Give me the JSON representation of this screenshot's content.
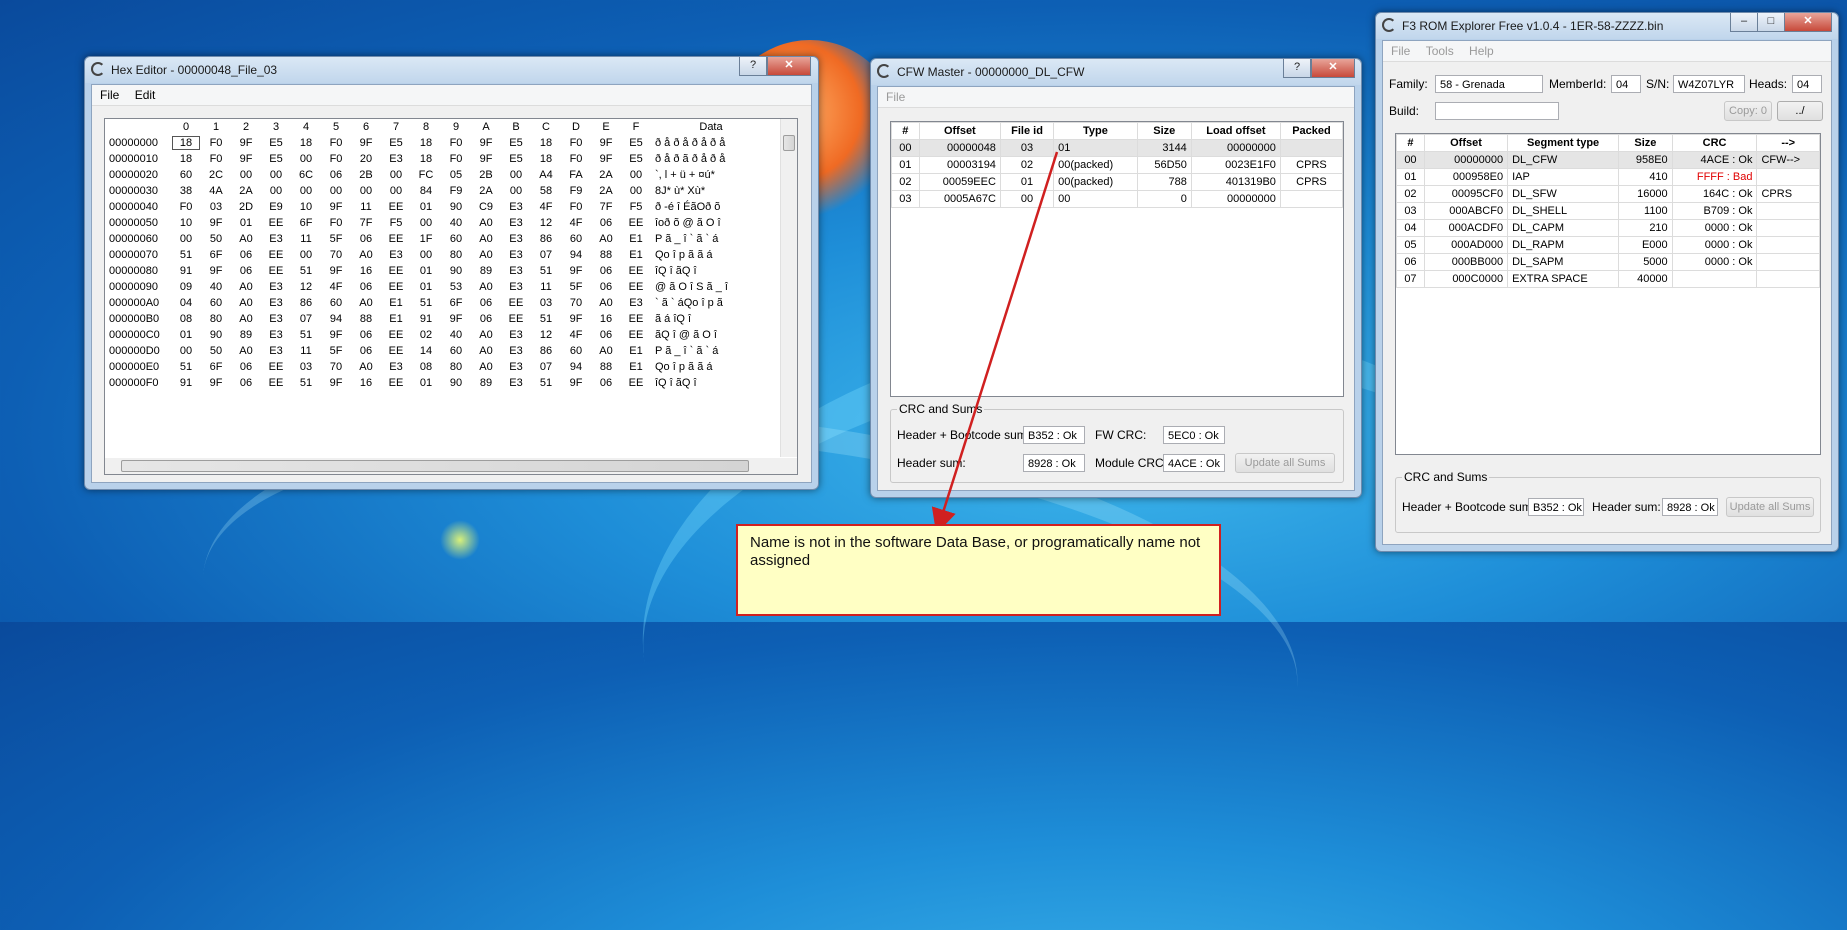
{
  "hex_editor": {
    "title": "Hex Editor - 00000048_File_03",
    "menu": [
      "File",
      "Edit"
    ],
    "columns": [
      "0",
      "1",
      "2",
      "3",
      "4",
      "5",
      "6",
      "7",
      "8",
      "9",
      "A",
      "B",
      "C",
      "D",
      "E",
      "F"
    ],
    "data_header": "Data",
    "rows": [
      {
        "addr": "00000000",
        "bytes": [
          "18",
          "F0",
          "9F",
          "E5",
          "18",
          "F0",
          "9F",
          "E5",
          "18",
          "F0",
          "9F",
          "E5",
          "18",
          "F0",
          "9F",
          "E5"
        ],
        "ascii": "ð å ð å ð å ð å"
      },
      {
        "addr": "00000010",
        "bytes": [
          "18",
          "F0",
          "9F",
          "E5",
          "00",
          "F0",
          "20",
          "E3",
          "18",
          "F0",
          "9F",
          "E5",
          "18",
          "F0",
          "9F",
          "E5"
        ],
        "ascii": "ð å ð ã ð å ð å"
      },
      {
        "addr": "00000020",
        "bytes": [
          "60",
          "2C",
          "00",
          "00",
          "6C",
          "06",
          "2B",
          "00",
          "FC",
          "05",
          "2B",
          "00",
          "A4",
          "FA",
          "2A",
          "00"
        ],
        "ascii": "`,   l + ü + ¤ú*"
      },
      {
        "addr": "00000030",
        "bytes": [
          "38",
          "4A",
          "2A",
          "00",
          "00",
          "00",
          "00",
          "00",
          "84",
          "F9",
          "2A",
          "00",
          "58",
          "F9",
          "2A",
          "00"
        ],
        "ascii": "8J*   ù* Xù*"
      },
      {
        "addr": "00000040",
        "bytes": [
          "F0",
          "03",
          "2D",
          "E9",
          "10",
          "9F",
          "11",
          "EE",
          "01",
          "90",
          "C9",
          "E3",
          "4F",
          "F0",
          "7F",
          "F5"
        ],
        "ascii": "ð -é  î ÉãOð õ"
      },
      {
        "addr": "00000050",
        "bytes": [
          "10",
          "9F",
          "01",
          "EE",
          "6F",
          "F0",
          "7F",
          "F5",
          "00",
          "40",
          "A0",
          "E3",
          "12",
          "4F",
          "06",
          "EE"
        ],
        "ascii": "  îoð õ @ ã O î"
      },
      {
        "addr": "00000060",
        "bytes": [
          "00",
          "50",
          "A0",
          "E3",
          "11",
          "5F",
          "06",
          "EE",
          "1F",
          "60",
          "A0",
          "E3",
          "86",
          "60",
          "A0",
          "E1"
        ],
        "ascii": " P ã _ î ` ã  ` á"
      },
      {
        "addr": "00000070",
        "bytes": [
          "51",
          "6F",
          "06",
          "EE",
          "00",
          "70",
          "A0",
          "E3",
          "00",
          "80",
          "A0",
          "E3",
          "07",
          "94",
          "88",
          "E1"
        ],
        "ascii": "Qo î p ã  ã   á"
      },
      {
        "addr": "00000080",
        "bytes": [
          "91",
          "9F",
          "06",
          "EE",
          "51",
          "9F",
          "16",
          "EE",
          "01",
          "90",
          "89",
          "E3",
          "51",
          "9F",
          "06",
          "EE"
        ],
        "ascii": " îQ î  ãQ î"
      },
      {
        "addr": "00000090",
        "bytes": [
          "09",
          "40",
          "A0",
          "E3",
          "12",
          "4F",
          "06",
          "EE",
          "01",
          "53",
          "A0",
          "E3",
          "11",
          "5F",
          "06",
          "EE"
        ],
        "ascii": " @ ã O î S ã _ î"
      },
      {
        "addr": "000000A0",
        "bytes": [
          "04",
          "60",
          "A0",
          "E3",
          "86",
          "60",
          "A0",
          "E1",
          "51",
          "6F",
          "06",
          "EE",
          "03",
          "70",
          "A0",
          "E3"
        ],
        "ascii": " ` ã `  áQo î p ã"
      },
      {
        "addr": "000000B0",
        "bytes": [
          "08",
          "80",
          "A0",
          "E3",
          "07",
          "94",
          "88",
          "E1",
          "91",
          "9F",
          "06",
          "EE",
          "51",
          "9F",
          "16",
          "EE"
        ],
        "ascii": "  ã   á  îQ î"
      },
      {
        "addr": "000000C0",
        "bytes": [
          "01",
          "90",
          "89",
          "E3",
          "51",
          "9F",
          "06",
          "EE",
          "02",
          "40",
          "A0",
          "E3",
          "12",
          "4F",
          "06",
          "EE"
        ],
        "ascii": " ãQ î @ ã O î"
      },
      {
        "addr": "000000D0",
        "bytes": [
          "00",
          "50",
          "A0",
          "E3",
          "11",
          "5F",
          "06",
          "EE",
          "14",
          "60",
          "A0",
          "E3",
          "86",
          "60",
          "A0",
          "E1"
        ],
        "ascii": " P ã _ î ` ã  ` á"
      },
      {
        "addr": "000000E0",
        "bytes": [
          "51",
          "6F",
          "06",
          "EE",
          "03",
          "70",
          "A0",
          "E3",
          "08",
          "80",
          "A0",
          "E3",
          "07",
          "94",
          "88",
          "E1"
        ],
        "ascii": "Qo î p ã  ã   á"
      },
      {
        "addr": "000000F0",
        "bytes": [
          "91",
          "9F",
          "06",
          "EE",
          "51",
          "9F",
          "16",
          "EE",
          "01",
          "90",
          "89",
          "E3",
          "51",
          "9F",
          "06",
          "EE"
        ],
        "ascii": " îQ î  ãQ î"
      }
    ]
  },
  "cfw_master": {
    "title": "CFW Master - 00000000_DL_CFW",
    "menu": [
      "File"
    ],
    "headers": [
      "#",
      "Offset",
      "File id",
      "Type",
      "Size",
      "Load offset",
      "Packed"
    ],
    "rows": [
      [
        "00",
        "00000048",
        "03",
        "01",
        "3144",
        "00000000",
        ""
      ],
      [
        "01",
        "00003194",
        "02",
        "00(packed)",
        "56D50",
        "0023E1F0",
        "CPRS"
      ],
      [
        "02",
        "00059EEC",
        "01",
        "00(packed)",
        "788",
        "401319B0",
        "CPRS"
      ],
      [
        "03",
        "0005A67C",
        "00",
        "00",
        "0",
        "00000000",
        ""
      ]
    ],
    "crc_group": "CRC and Sums",
    "header_bootcode_label": "Header + Bootcode sum:",
    "header_bootcode_value": "B352 : Ok",
    "fw_crc_label": "FW CRC:",
    "fw_crc_value": "5EC0 : Ok",
    "header_sum_label": "Header sum:",
    "header_sum_value": "8928 : Ok",
    "module_crc_label": "Module CRC:",
    "module_crc_value": "4ACE : Ok",
    "update_button": "Update all Sums"
  },
  "rom_explorer": {
    "title": "F3 ROM Explorer Free v1.0.4 - 1ER-58-ZZZZ.bin",
    "menu": [
      "File",
      "Tools",
      "Help"
    ],
    "family_label": "Family:",
    "family_value": "58 - Grenada",
    "memberid_label": "MemberId:",
    "memberid_value": "04",
    "sn_label": "S/N:",
    "sn_value": "W4Z07LYR",
    "heads_label": "Heads:",
    "heads_value": "04",
    "build_label": "Build:",
    "build_value": "",
    "copy_button": "Copy: 0",
    "up_button": "../",
    "headers": [
      "#",
      "Offset",
      "Segment type",
      "Size",
      "CRC",
      "-->"
    ],
    "rows": [
      [
        "00",
        "00000000",
        "DL_CFW",
        "958E0",
        "4ACE : Ok",
        "CFW-->"
      ],
      [
        "01",
        "000958E0",
        "IAP",
        "410",
        "FFFF : Bad",
        ""
      ],
      [
        "02",
        "00095CF0",
        "DL_SFW",
        "16000",
        "164C : Ok",
        "CPRS"
      ],
      [
        "03",
        "000ABCF0",
        "DL_SHELL",
        "1100",
        "B709 : Ok",
        ""
      ],
      [
        "04",
        "000ACDF0",
        "DL_CAPM",
        "210",
        "0000 : Ok",
        ""
      ],
      [
        "05",
        "000AD000",
        "DL_RAPM",
        "E000",
        "0000 : Ok",
        ""
      ],
      [
        "06",
        "000BB000",
        "DL_SAPM",
        "5000",
        "0000 : Ok",
        ""
      ],
      [
        "07",
        "000C0000",
        "EXTRA SPACE",
        "40000",
        "",
        ""
      ]
    ],
    "crc_group": "CRC and Sums",
    "header_bootcode_label": "Header + Bootcode sum:",
    "header_bootcode_value": "B352 : Ok",
    "header_sum_label": "Header sum:",
    "header_sum_value": "8928 : Ok",
    "update_button": "Update all Sums"
  },
  "annotation": {
    "text": "Name is not in the software Data Base, or programatically name not assigned"
  },
  "window_buttons": {
    "help": "?",
    "close": "✕",
    "minimize": "–",
    "maximize": "□"
  },
  "colors": {
    "bad": "#e00000",
    "annotation_border": "#d02020",
    "annotation_fill": "#ffffc4"
  }
}
